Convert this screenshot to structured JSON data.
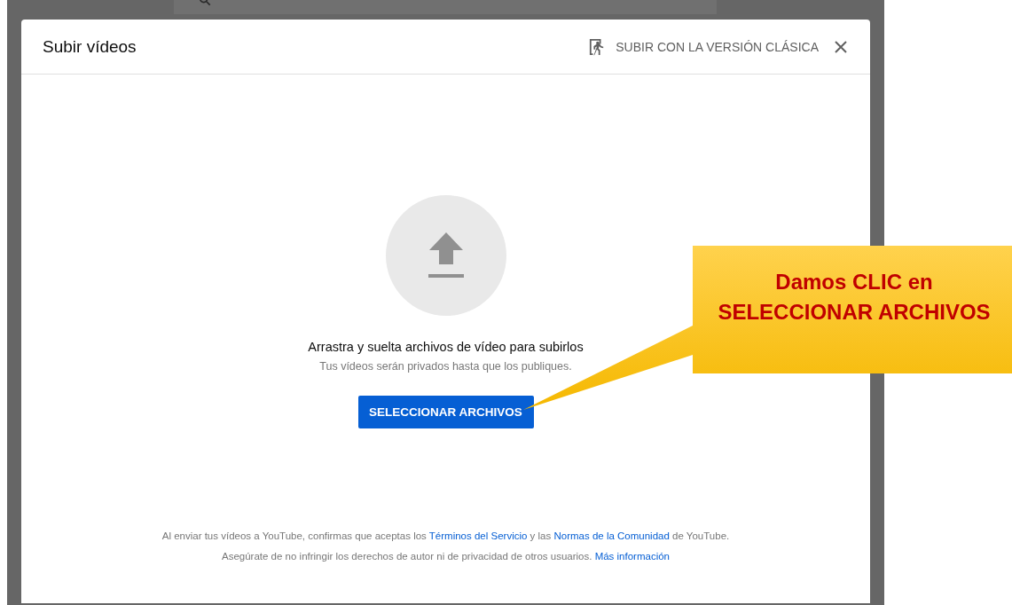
{
  "dialog": {
    "title": "Subir vídeos",
    "classic_link": "SUBIR CON LA VERSIÓN CLÁSICA",
    "drop_title": "Arrastra y suelta archivos de vídeo para subirlos",
    "drop_subtitle": "Tus vídeos serán privados hasta que los publiques.",
    "select_button": "SELECCIONAR ARCHIVOS",
    "footer": [
      [
        {
          "kind": "text",
          "text": "Al enviar tus vídeos a YouTube, confirmas que aceptas los "
        },
        {
          "kind": "link",
          "text": "Términos del Servicio"
        },
        {
          "kind": "text",
          "text": " y las "
        },
        {
          "kind": "link",
          "text": "Normas de la Comunidad"
        },
        {
          "kind": "text",
          "text": " de YouTube."
        }
      ],
      [
        {
          "kind": "text",
          "text": "Asegúrate de no infringir los derechos de autor ni de privacidad de otros usuarios. "
        },
        {
          "kind": "link",
          "text": "Más información"
        }
      ]
    ]
  },
  "callout": {
    "text": "Damos CLIC en SELECCIONAR ARCHIVOS"
  }
}
